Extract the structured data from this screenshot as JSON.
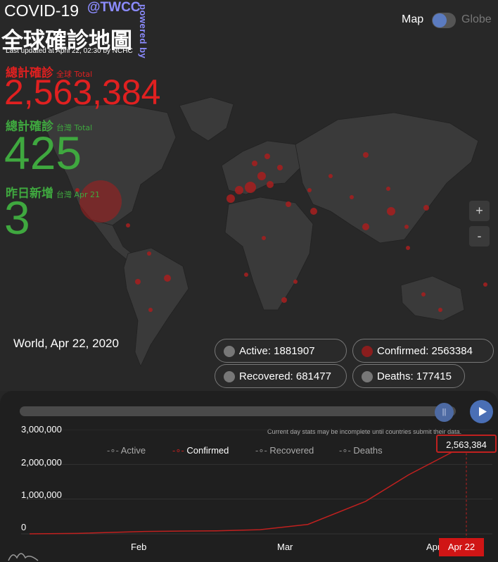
{
  "header": {
    "title": "COVID-19",
    "twcc": "@TWCC",
    "powered_by": "powered by",
    "subtitle": "全球確診地圖",
    "updated": "Last updated at April 22, 02:30 by NCHC"
  },
  "stats": {
    "global": {
      "label": "總計確診",
      "sublabel": "全球 Total",
      "value": "2,563,384"
    },
    "taiwan": {
      "label": "總計確診",
      "sublabel": "台灣 Total",
      "value": "425"
    },
    "daily": {
      "label": "昨日新增",
      "sublabel": "台灣 Apr 21",
      "value": "3"
    }
  },
  "view_toggle": {
    "map_label": "Map",
    "globe_label": "Globe"
  },
  "zoom": {
    "in": "+",
    "out": "-"
  },
  "location": "World, Apr 22, 2020",
  "pills": {
    "active": "Active: 1881907",
    "confirmed": "Confirmed: 2563384",
    "recovered": "Recovered: 681477",
    "deaths": "Deaths: 177415"
  },
  "timeline": {
    "note": "Current day stats may be incomplete until countries submit their data.",
    "pause_icon": "||",
    "callout": "2,563,384",
    "date_badge": "Apr 22"
  },
  "colors": {
    "confirmed": "#e02020",
    "taiwan_green": "#3fa83f",
    "toggle_blue": "#5b7bc0",
    "bubble": "#a81e1e"
  },
  "chart_data": {
    "type": "line",
    "legend": [
      "Active",
      "Confirmed",
      "Recovered",
      "Deaths"
    ],
    "ytick_labels": [
      "3,000,000",
      "2,000,000",
      "1,000,000",
      "0"
    ],
    "xtick_labels": [
      "Feb",
      "Mar",
      "Apr"
    ],
    "ylim": [
      0,
      3000000
    ],
    "series": [
      {
        "name": "Confirmed",
        "color": "#c0201f",
        "x": [
          "Jan 22",
          "Feb 1",
          "Feb 15",
          "Mar 1",
          "Mar 10",
          "Mar 20",
          "Apr 1",
          "Apr 10",
          "Apr 22"
        ],
        "y": [
          555,
          12000,
          69000,
          88000,
          119000,
          272000,
          935000,
          1700000,
          2563384
        ]
      }
    ]
  }
}
